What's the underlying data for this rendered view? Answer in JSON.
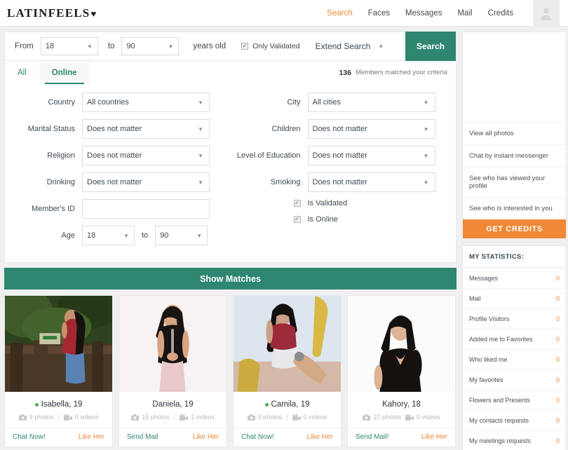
{
  "header": {
    "logo_text": "LATINFEELS",
    "logo_heart": "♥",
    "nav": [
      {
        "label": "Search",
        "active": true
      },
      {
        "label": "Faces",
        "active": false
      },
      {
        "label": "Messages",
        "active": false
      },
      {
        "label": "Mail",
        "active": false
      },
      {
        "label": "Credits",
        "active": false
      }
    ],
    "avatar_icon": "user-avatar-icon"
  },
  "searchbar": {
    "from_label": "From",
    "age_from": "18",
    "to_label": "to",
    "age_to": "90",
    "years_old_label": "years old",
    "only_validated_label": "Only Validated",
    "only_validated_checked": true,
    "extend_search_label": "Extend Search",
    "search_button": "Search"
  },
  "tabs": {
    "items": [
      {
        "label": "All",
        "active": false
      },
      {
        "label": "Online",
        "active": true
      }
    ],
    "match_count": "136",
    "match_text": "Members matched your criteria"
  },
  "filters": {
    "left": [
      {
        "label": "Country",
        "value": "All countries",
        "type": "select"
      },
      {
        "label": "Marital Status",
        "value": "Does not matter",
        "type": "select"
      },
      {
        "label": "Religion",
        "value": "Does not matter",
        "type": "select"
      },
      {
        "label": "Drinking",
        "value": "Does not matter",
        "type": "select"
      },
      {
        "label": "Member's ID",
        "value": "",
        "type": "text"
      }
    ],
    "age_label": "Age",
    "age_from": "18",
    "age_to_label": "to",
    "age_to": "90",
    "right": [
      {
        "label": "City",
        "value": "All cities",
        "type": "select"
      },
      {
        "label": "Children",
        "value": "Does not matter",
        "type": "select"
      },
      {
        "label": "Level of Education",
        "value": "Does not matter",
        "type": "select"
      },
      {
        "label": "Smoking",
        "value": "Does not matter",
        "type": "select"
      }
    ],
    "checkboxes": [
      {
        "label": "Is Validated",
        "checked": true
      },
      {
        "label": "Is Online",
        "checked": true
      }
    ],
    "show_matches_label": "Show Matches"
  },
  "cards": [
    {
      "name": "Isabella, 19",
      "online": true,
      "photos": "9 photos",
      "videos": "0 videos",
      "action_primary": "Chat Now!",
      "action_like": "Like Her"
    },
    {
      "name": "Daniela, 19",
      "online": false,
      "photos": "15 photos",
      "videos": "1 videos",
      "action_primary": "Send Mail",
      "action_like": "Like Her"
    },
    {
      "name": "Camila, 19",
      "online": true,
      "photos": "9 photos",
      "videos": "0 videos",
      "action_primary": "Chat Now!",
      "action_like": "Like Her"
    },
    {
      "name": "Kahory, 18",
      "online": false,
      "photos": "27 photos",
      "videos": "0 videos",
      "action_primary": "Send Mail!",
      "action_like": "Like Her"
    }
  ],
  "sidebar": {
    "promo_links": [
      "View all photos",
      "Chat by instant messenger",
      "See who has viewed your profile",
      "See who is interested in you"
    ],
    "get_credits_label": "GET CREDITS",
    "stats_title": "MY STATISTICS:",
    "stats": [
      {
        "label": "Messages",
        "value": "0"
      },
      {
        "label": "Mail",
        "value": "0"
      },
      {
        "label": "Profile Visitors",
        "value": "0"
      },
      {
        "label": "Added me to Favorites",
        "value": "0"
      },
      {
        "label": "Who liked me",
        "value": "0"
      },
      {
        "label": "My favorites",
        "value": "0"
      },
      {
        "label": "Flowers and Presents",
        "value": "0"
      },
      {
        "label": "My contacts requests",
        "value": "0"
      },
      {
        "label": "My meetings requests",
        "value": "0"
      }
    ]
  },
  "colors": {
    "teal": "#2e8670",
    "orange": "#ef8936",
    "online_dot": "#4caf50"
  }
}
